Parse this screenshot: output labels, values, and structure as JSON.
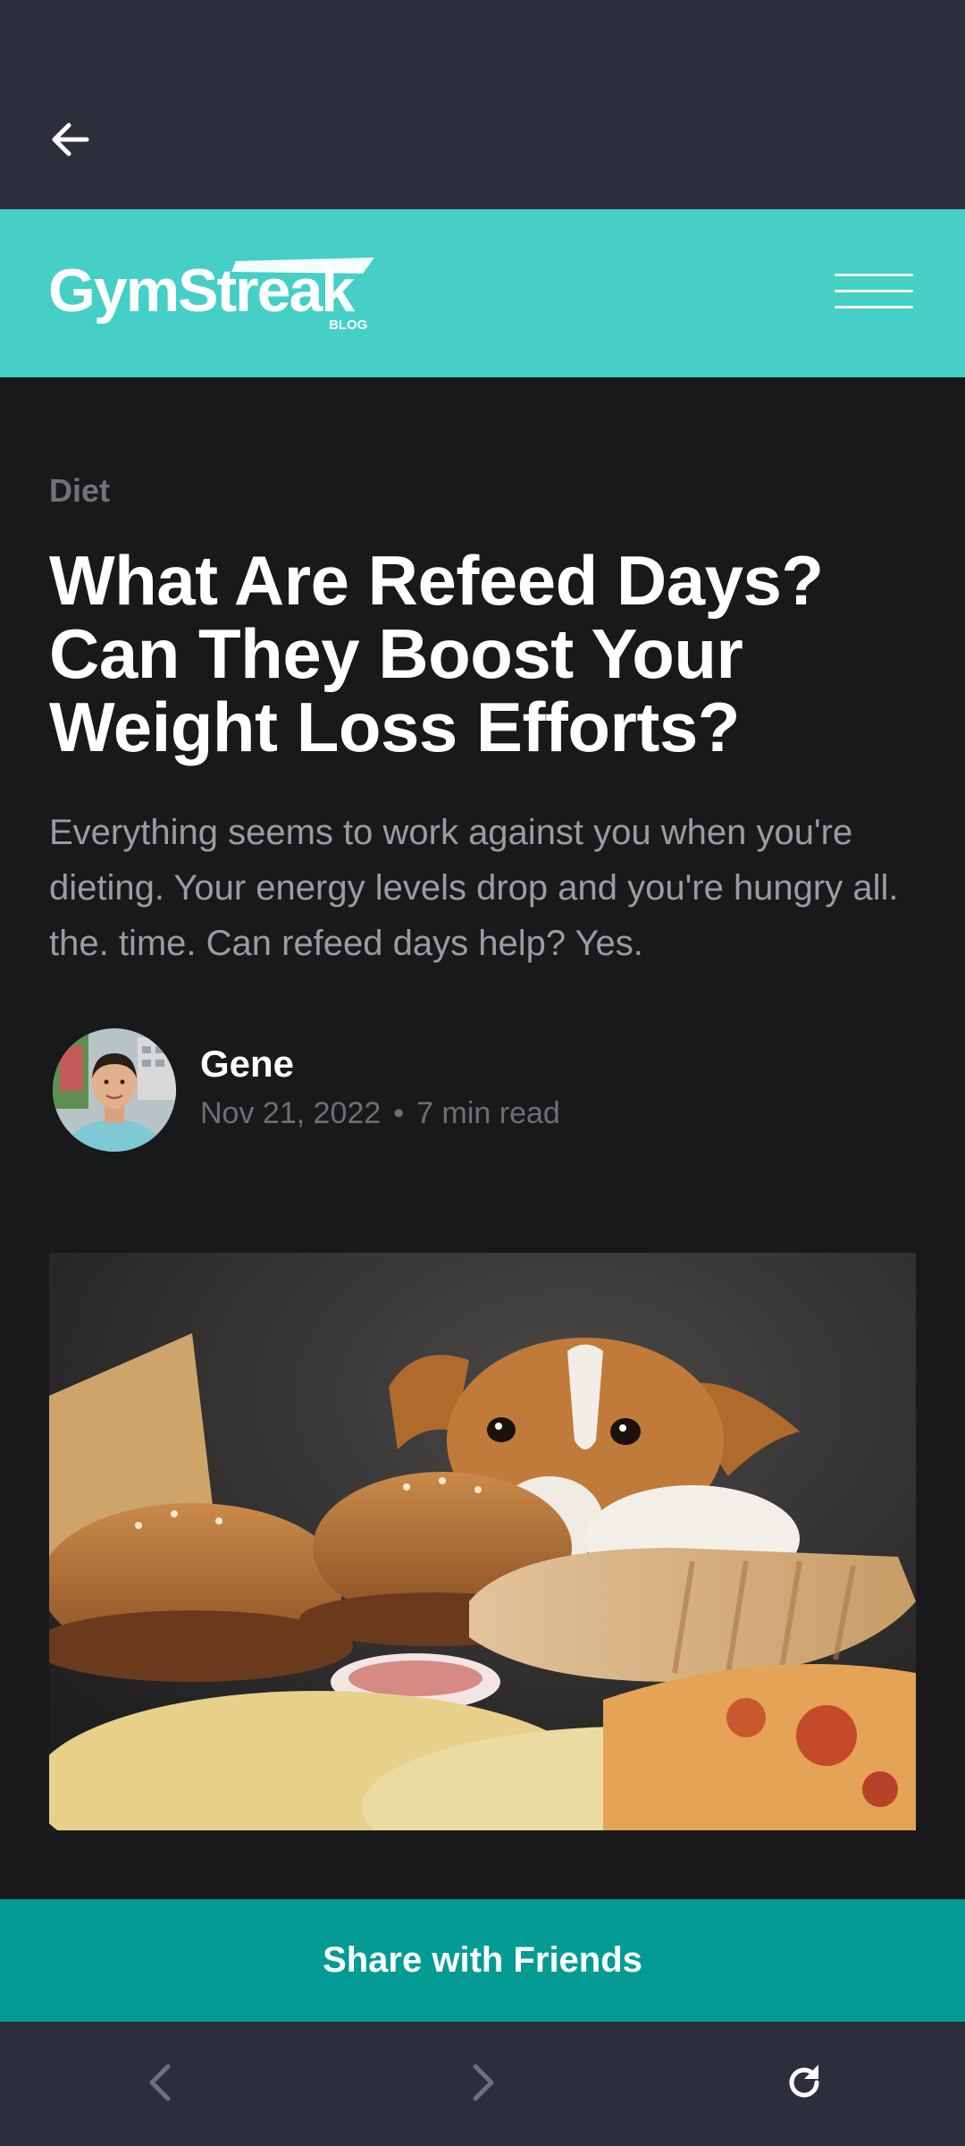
{
  "browser": {
    "back_icon": "arrow-left-icon",
    "nav_back_icon": "chevron-left-icon",
    "nav_forward_icon": "chevron-right-icon",
    "refresh_icon": "refresh-icon"
  },
  "header": {
    "logo_text": "GymStreak",
    "logo_sub": "BLOG",
    "menu_icon": "hamburger-menu-icon",
    "bg_color": "#45cfc6"
  },
  "article": {
    "category": "Diet",
    "title": "What Are Refeed Days? Can They Boost Your Weight Loss Efforts?",
    "subtitle": "Everything seems to work against you when you're dieting. Your energy levels drop and you're hungry all. the. time. Can refeed days help? Yes.",
    "author": {
      "name": "Gene",
      "date": "Nov 21, 2022",
      "separator": "•",
      "read_time": "7 min read"
    }
  },
  "share": {
    "label": "Share with Friends",
    "bg_color": "#049b95"
  }
}
